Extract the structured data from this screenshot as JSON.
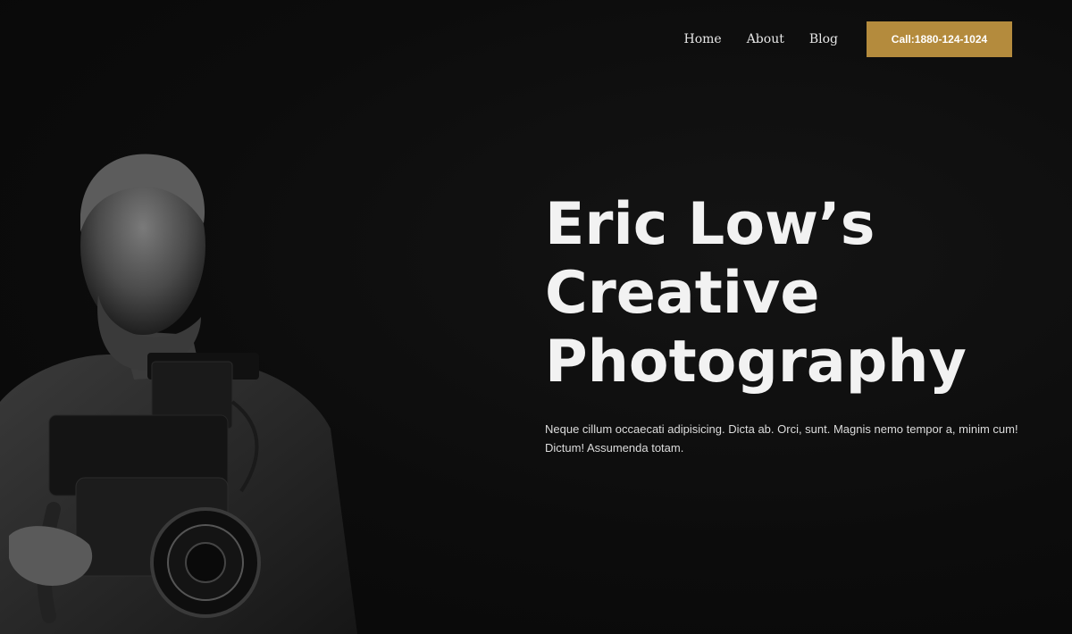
{
  "nav": {
    "items": [
      {
        "label": "Home"
      },
      {
        "label": "About"
      },
      {
        "label": "Blog"
      }
    ],
    "cta_label": "Call:1880-124-1024"
  },
  "hero": {
    "headline_lines": [
      "Eric Low’s",
      "Creative",
      "Photography"
    ],
    "intro": "Neque cillum occaecati adipisicing. Dicta ab. Orci, sunt. Magnis nemo tempor a, minim cum! Dictum! Assumenda totam."
  },
  "colors": {
    "background": "#0b0b0b",
    "accent": "#b48b3d",
    "text": "#f2f2f2"
  },
  "icons": {
    "photo": "photographer-with-camera-image"
  }
}
